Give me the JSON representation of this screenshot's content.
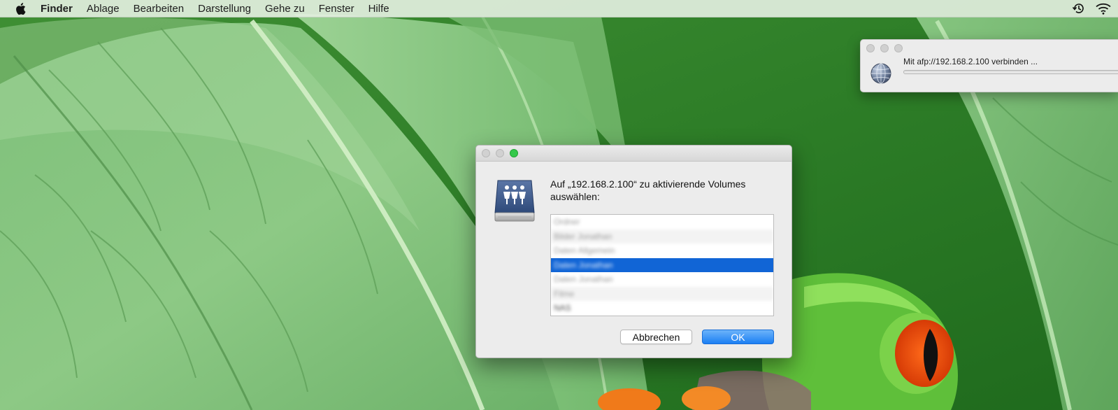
{
  "menubar": {
    "app_name": "Finder",
    "items": [
      "Ablage",
      "Bearbeiten",
      "Darstellung",
      "Gehe zu",
      "Fenster",
      "Hilfe"
    ],
    "status_icons": [
      "time-machine-icon",
      "wifi-icon"
    ]
  },
  "progress_window": {
    "message": "Mit afp://192.168.2.100 verbinden ...",
    "icon": "network-globe-icon"
  },
  "dialog": {
    "message": "Auf „192.168.2.100“ zu aktivierende Volumes auswählen:",
    "icon": "server-volume-icon",
    "volumes": [
      {
        "label": "Ordner",
        "selected": false
      },
      {
        "label": "Bilder Jonathan",
        "selected": false
      },
      {
        "label": "Daten Allgemein",
        "selected": false
      },
      {
        "label": "Daten Jonathan",
        "selected": true
      },
      {
        "label": "Daten Jonathan",
        "selected": false
      },
      {
        "label": "Filme",
        "selected": false
      },
      {
        "label": "NAS",
        "selected": false
      }
    ],
    "cancel_label": "Abbrechen",
    "ok_label": "OK"
  },
  "colors": {
    "selection": "#1165d6",
    "ok_button": "#1b7ff3",
    "zoom_button": "#34c84a"
  }
}
